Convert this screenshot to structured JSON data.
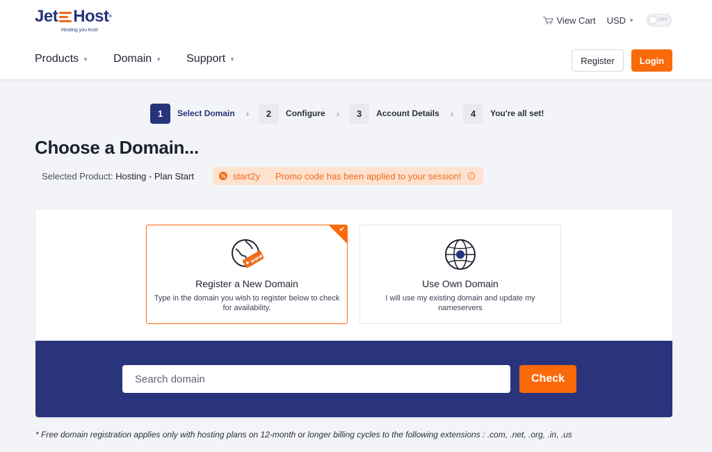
{
  "brand": {
    "name_left": "Jet",
    "name_right": "Host",
    "reg_mark": "®",
    "tagline": "Hosting you trust",
    "accent": "#f26a1b",
    "primary": "#27337a"
  },
  "topbar": {
    "cart_label": "View Cart",
    "currency": "USD",
    "toggle_label": "OFF"
  },
  "nav": {
    "items": [
      {
        "label": "Products"
      },
      {
        "label": "Domain"
      },
      {
        "label": "Support"
      }
    ],
    "register_label": "Register",
    "login_label": "Login"
  },
  "steps": [
    {
      "num": "1",
      "label": "Select Domain",
      "active": true
    },
    {
      "num": "2",
      "label": "Configure",
      "active": false
    },
    {
      "num": "3",
      "label": "Account Details",
      "active": false
    },
    {
      "num": "4",
      "label": "You're all set!",
      "active": false
    }
  ],
  "page": {
    "title": "Choose a Domain...",
    "selected_product_label": "Selected Product:",
    "selected_product_value": "Hosting - Plan Start"
  },
  "promo": {
    "code": "start2y",
    "message": "Promo code has been applied to your session!"
  },
  "options": [
    {
      "title": "Register a New Domain",
      "desc": "Type in the domain you wish to register below to check for availability.",
      "selected": true,
      "icon": "globe-www-icon",
      "badge": "www"
    },
    {
      "title": "Use Own Domain",
      "desc": "I will use my existing domain and update my nameservers",
      "selected": false,
      "icon": "globe-icon"
    }
  ],
  "search": {
    "placeholder": "Search domain",
    "button_label": "Check"
  },
  "footnote": "* Free domain registration applies only with hosting plans on 12-month or longer billing cycles to the following extensions : .com, .net, .org, .in, .us"
}
